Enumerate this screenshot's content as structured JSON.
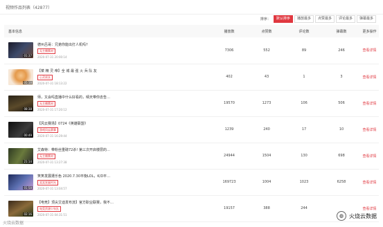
{
  "header": {
    "title": "视频作品列表（42877）"
  },
  "sort": {
    "label": "排序：",
    "buttons": [
      "默认排序",
      "播放最多",
      "点赞最多",
      "评论最多",
      "弹幕最多"
    ],
    "active_color": "#e0373f"
  },
  "table": {
    "columns": [
      "基本信息",
      "播放数",
      "点赞数",
      "评论数",
      "弹幕数",
      "更多操作"
    ],
    "rows": [
      {
        "title": "德州吕哥：兄弟你能出打人机吗?",
        "tag": "无主播素材",
        "date": "2020-07-31 20:00:14",
        "duration": "01:37",
        "plays": "7306",
        "likes": "552",
        "comments": "89",
        "danmaku": "246",
        "action": "查看详情"
      },
      {
        "title": "【菜 精 灵 帝】全 城 最 强 火 兵 队 友",
        "tag": "心灵成长",
        "date": "2020-07-31 18:13:22",
        "duration": "05:18",
        "plays": "402",
        "likes": "43",
        "comments": "1",
        "danmaku": "3",
        "action": "查看详情"
      },
      {
        "title": "师，又会吗直播中什么好看的，晴天带你去告…",
        "tag": "无主播素材",
        "date": "2020-07-31 17:20:12",
        "duration": "08:38",
        "plays": "19570",
        "likes": "1273",
        "comments": "106",
        "danmaku": "506",
        "action": "查看详情"
      },
      {
        "title": "【风云赛场】0724《英雄联盟》",
        "tag": "游戏风云赛事",
        "date": "2020-07-31 16:29:44",
        "duration": "00:49",
        "plays": "1239",
        "likes": "240",
        "comments": "17",
        "danmaku": "10",
        "action": "查看详情"
      },
      {
        "title": "艾森特：带粉丝重磅72杀! 第三次开启楼层的…",
        "tag": "无主播素材",
        "date": "2020-07-31 13:27:38",
        "duration": "21:14",
        "plays": "24944",
        "likes": "1504",
        "comments": "130",
        "danmaku": "698",
        "action": "查看详情"
      },
      {
        "title": "笑笑发展遭乐色 2020.7.30平衡LOL，K/D平衡…",
        "tag": "笑笑发展时光",
        "date": "2020-07-31 13:04:57",
        "duration": "01:58",
        "plays": "169723",
        "likes": "1004",
        "comments": "1023",
        "danmaku": "6258",
        "action": "查看详情"
      },
      {
        "title": "【电竞】顶尖艾迪发布流】官方职业联赛，我不…",
        "tag": "电竞资源少年队",
        "date": "2020-07-31 04:31:51",
        "duration": "02:16",
        "plays": "19157",
        "likes": "388",
        "comments": "244",
        "danmaku": "",
        "action": "查看详情"
      }
    ]
  },
  "watermark": {
    "text": "火烧云数据",
    "corner_text": "火烧云数据"
  }
}
